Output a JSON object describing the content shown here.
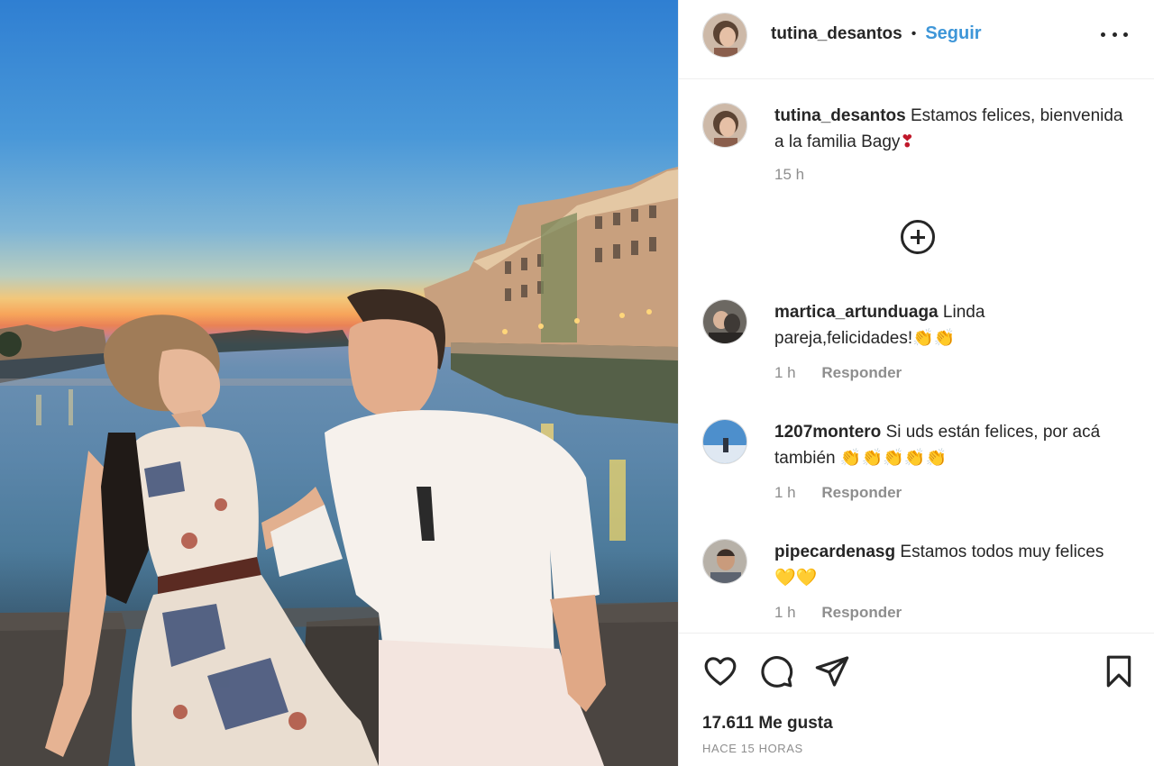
{
  "post": {
    "author": "tutina_desantos",
    "separator": "•",
    "follow_label": "Seguir",
    "more_label": "More options"
  },
  "caption": {
    "username": "tutina_desantos",
    "text": "Estamos felices, bienvenida a la familia Bagy",
    "emoji": "❣",
    "time": "15 h"
  },
  "load_more_label": "Load more comments",
  "comments": [
    {
      "username": "martica_artunduaga",
      "text": "Linda pareja,felicidades!",
      "emoji": "👏👏",
      "time": "1 h",
      "reply": "Responder"
    },
    {
      "username": "1207montero",
      "text": "Si uds están felices, por acá también",
      "emoji": "👏👏👏👏👏",
      "time": "1 h",
      "reply": "Responder"
    },
    {
      "username": "pipecardenasg",
      "text": "Estamos todos muy felices",
      "emoji": "💛💛",
      "time": "1 h",
      "reply": "Responder"
    }
  ],
  "actions": {
    "icons": [
      "heart-icon",
      "comment-icon",
      "share-icon",
      "bookmark-icon"
    ]
  },
  "likes_text": "17.611 Me gusta",
  "posted_ago": "HACE 15 HORAS",
  "colors": {
    "follow": "#3e96d8",
    "text": "#262626",
    "muted": "#8e8e8e",
    "border": "#efefef"
  }
}
